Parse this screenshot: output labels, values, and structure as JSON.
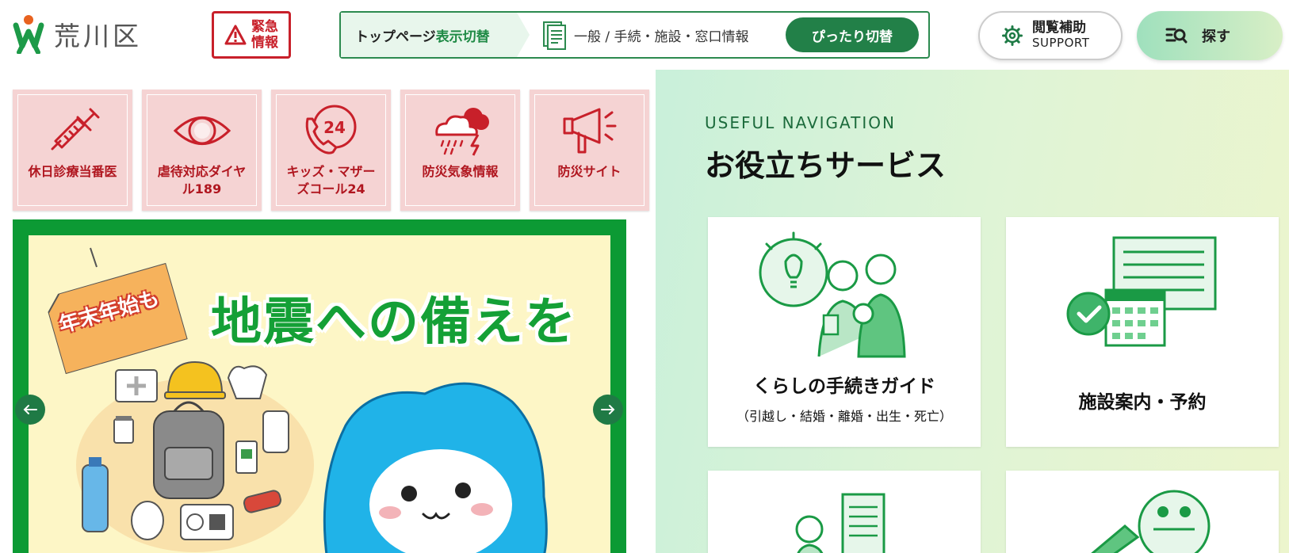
{
  "header": {
    "logo_text": "荒川区",
    "emergency": {
      "line1": "緊急",
      "line2": "情報"
    },
    "toggle": {
      "label_prefix": "トップページ",
      "label_accent": "表示切替",
      "current_mode": "一般 / 手続・施設・窓口情報",
      "button_label": "ぴったり切替"
    },
    "support": {
      "main": "閲覧補助",
      "sub": "SUPPORT"
    },
    "search": {
      "label": "探す"
    }
  },
  "quick_links": [
    {
      "label": "休日診療当番医",
      "icon": "syringe-icon"
    },
    {
      "label": "虐待対応ダイヤル189",
      "icon": "eye-icon"
    },
    {
      "label": "キッズ・マザーズコール24",
      "icon": "phone-24-icon"
    },
    {
      "label": "防災気象情報",
      "icon": "storm-cloud-icon"
    },
    {
      "label": "防災サイト",
      "icon": "megaphone-icon"
    }
  ],
  "banner": {
    "title": "地震への備えを",
    "tag": "年末年始も"
  },
  "useful": {
    "eyebrow": "USEFUL NAVIGATION",
    "title": "お役立ちサービス",
    "cards": [
      {
        "label": "くらしの手続きガイド",
        "sub": "（引越し・結婚・離婚・出生・死亡）"
      },
      {
        "label": "施設案内・予約",
        "sub": ""
      }
    ]
  },
  "colors": {
    "brand_green": "#228048",
    "emergency_red": "#c8202a",
    "quick_bg": "#f5d3d3",
    "banner_green": "#0c9a34"
  }
}
